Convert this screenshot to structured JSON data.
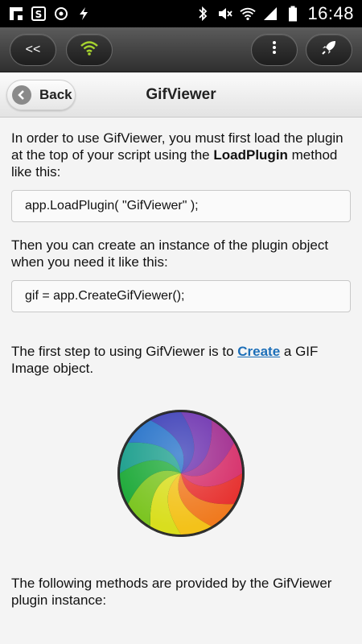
{
  "status_bar": {
    "time": "16:48",
    "left_icons": [
      "flipboard-icon",
      "s-app-icon",
      "sync-icon",
      "bolt-icon"
    ],
    "right_icons": [
      "bluetooth-icon",
      "mute-icon",
      "wifi-icon",
      "signal-icon",
      "battery-icon"
    ]
  },
  "toolbar": {
    "back_label": "<<"
  },
  "header": {
    "back_label": "Back",
    "title": "GifViewer"
  },
  "content": {
    "intro_part1": "In order to use GifViewer, you must first load the plugin at the top of your script using the ",
    "intro_bold": "LoadPlugin",
    "intro_part2": " method like this:",
    "code1": "app.LoadPlugin( \"GifViewer\" );",
    "instance_text": "Then you can create an instance of the plugin object when you need it like this:",
    "code2": "gif = app.CreateGifViewer();",
    "first_step_part1": "The first step to using GifViewer is to ",
    "first_step_link": "Create",
    "first_step_part2": " a GIF Image object.",
    "methods_text": "The following methods are provided by the GifViewer plugin instance:"
  },
  "colors": {
    "link": "#1d6fb8",
    "wifi_accent": "#a6d32f"
  }
}
